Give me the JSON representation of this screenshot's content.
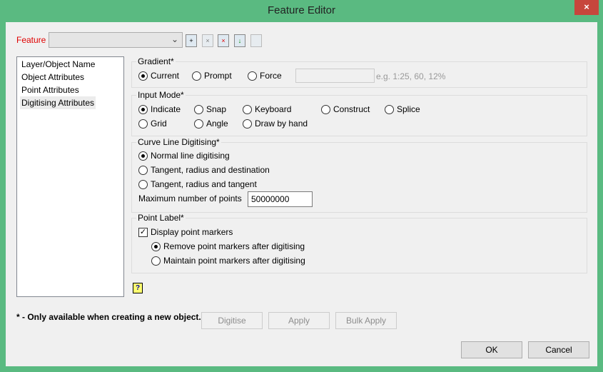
{
  "window": {
    "title": "Feature Editor",
    "close_icon": "×"
  },
  "feature": {
    "label": "Feature",
    "value": "",
    "toolbar": [
      "new-feature",
      "delete-feature",
      "delete-all-features",
      "import-feature",
      "copy-feature"
    ]
  },
  "nav": {
    "items": [
      "Layer/Object Name",
      "Object Attributes",
      "Point Attributes",
      "Digitising Attributes"
    ],
    "selected": "Digitising Attributes"
  },
  "gradient": {
    "title": "Gradient*",
    "options": [
      "Current",
      "Prompt",
      "Force"
    ],
    "selected": "Current",
    "value": "",
    "hint": "e.g. 1:25, 60, 12%"
  },
  "input_mode": {
    "title": "Input Mode*",
    "options": [
      "Indicate",
      "Snap",
      "Keyboard",
      "Construct",
      "Splice",
      "Grid",
      "Angle",
      "Draw by hand"
    ],
    "selected": "Indicate"
  },
  "curve": {
    "title": "Curve Line Digitising*",
    "options": [
      "Normal line digitising",
      "Tangent, radius and destination",
      "Tangent, radius and tangent"
    ],
    "selected": "Normal line digitising",
    "max_label": "Maximum number of points",
    "max_value": "50000000"
  },
  "point_label": {
    "title": "Point Label*",
    "display_markers": "Display point markers",
    "display_checked": true,
    "options": [
      "Remove point markers after digitising",
      "Maintain point markers after digitising"
    ],
    "selected": "Remove point markers after digitising"
  },
  "help_icon": "?",
  "footnote": "* - Only available when creating a new object.",
  "buttons": {
    "digitise": "Digitise",
    "apply": "Apply",
    "bulk_apply": "Bulk Apply",
    "ok": "OK",
    "cancel": "Cancel"
  }
}
